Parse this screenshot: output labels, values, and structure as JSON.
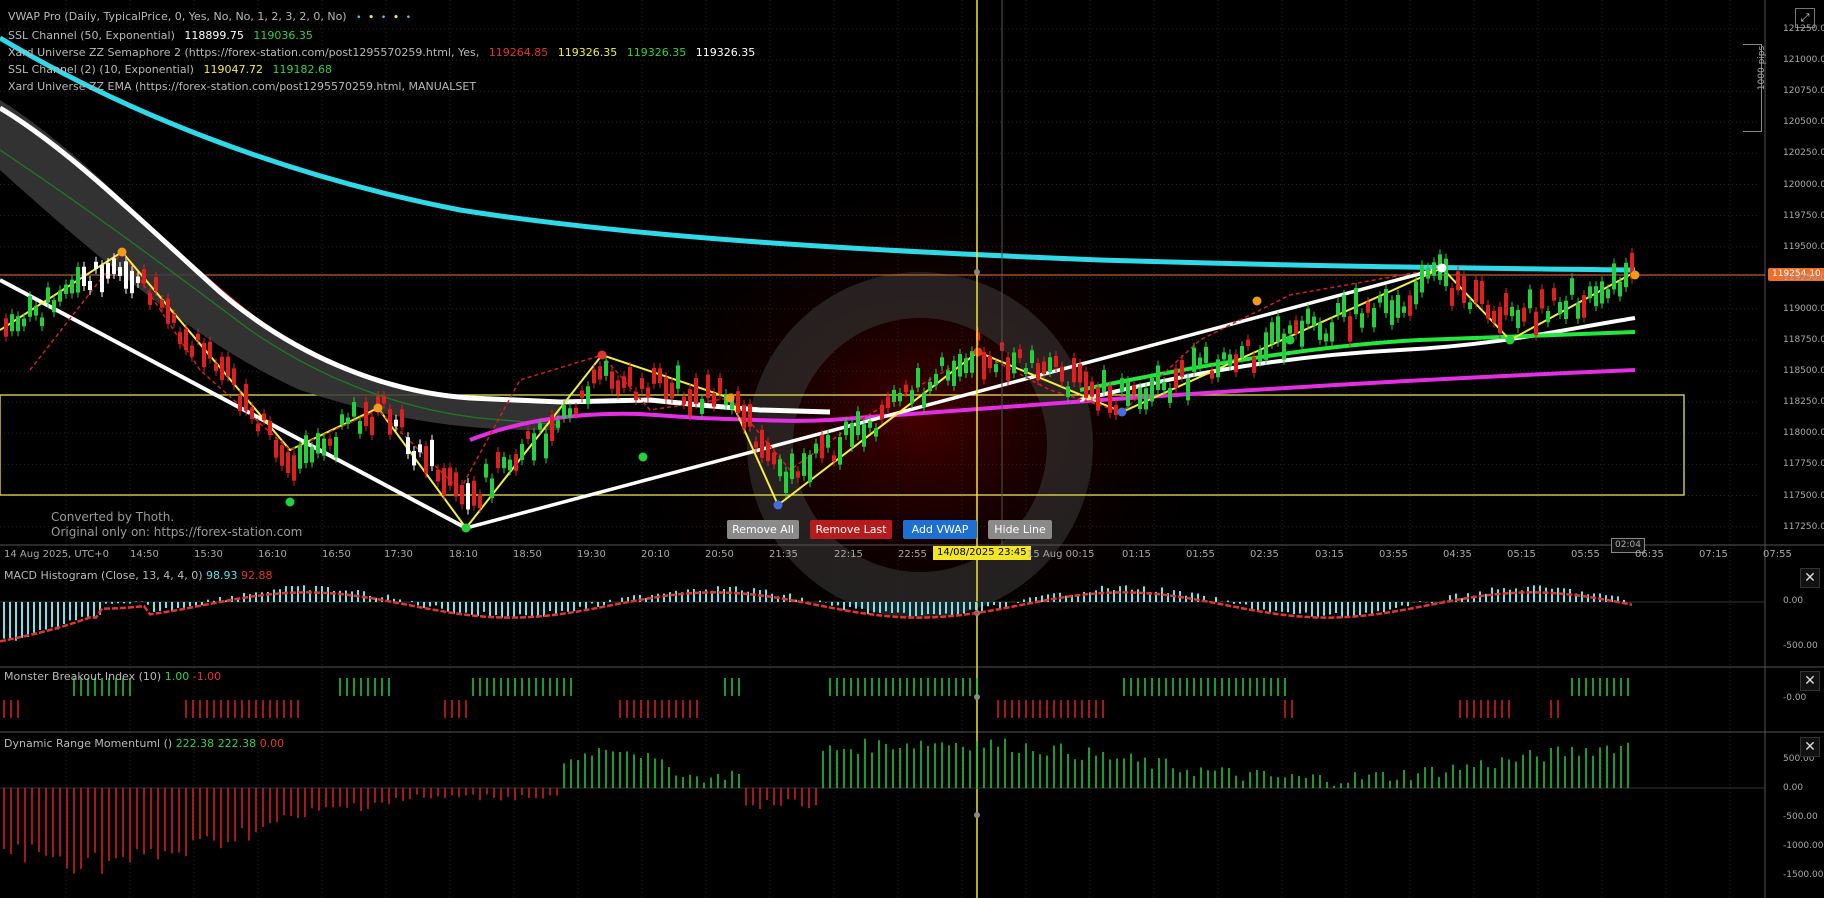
{
  "legend": {
    "vwap": {
      "label": "VWAP Pro (Daily, TypicalPrice, 0, Yes, No, No, 1, 2, 3, 2, 0, No)"
    },
    "ssl50": {
      "label": "SSL Channel (50, Exponential)",
      "v1": "118899.75",
      "v2": "119036.35"
    },
    "zz": {
      "label": "Xard Universe ZZ Semaphore 2 (https://forex-station.com/post1295570259.html, Yes,",
      "v1": "119264.85",
      "v2": "119326.35",
      "v3": "119326.35",
      "v4": "119326.35"
    },
    "ssl2": {
      "label": "SSL Channel (2) (10, Exponential)",
      "v1": "119047.72",
      "v2": "119182.68"
    },
    "ema": {
      "label": "Xard Universe ZZ EMA (https://forex-station.com/post1295570259.html, MANUALSET"
    }
  },
  "buttons": {
    "remove_all": "Remove All",
    "remove_last": "Remove Last",
    "add_vwap": "Add VWAP",
    "hide_line": "Hide Line"
  },
  "watermark": {
    "line1": "Converted by Thoth.",
    "line2": "Original only on: https://forex-station.com"
  },
  "pips_label": "1000 pips",
  "current_price": "119254.10",
  "cursor_date": "14/08/2025 23:45",
  "countdown": "02:04",
  "price_axis": [
    "121250.00",
    "121000.00",
    "120750.00",
    "120500.00",
    "120250.00",
    "120000.00",
    "119750.00",
    "119500.00",
    "119250.00",
    "119000.00",
    "118750.00",
    "118500.00",
    "118250.00",
    "118000.00",
    "117750.00",
    "117500.00",
    "117250.00"
  ],
  "time_axis": [
    "14 Aug 2025, UTC+0",
    "14:50",
    "15:30",
    "16:10",
    "16:50",
    "17:30",
    "18:10",
    "18:50",
    "19:30",
    "20:10",
    "20:50",
    "21:35",
    "22:15",
    "22:55",
    "",
    "15 Aug 00:15",
    "01:15",
    "01:55",
    "02:35",
    "03:15",
    "03:55",
    "04:35",
    "05:15",
    "05:55",
    "06:35",
    "07:15",
    "07:55"
  ],
  "panels": {
    "macd": {
      "label": "MACD Histogram (Close, 13, 4, 4, 0)",
      "v1": "98.93",
      "v2": "92.88",
      "axis": [
        "0.00",
        "-500.00"
      ]
    },
    "monster": {
      "label": "Monster Breakout Index (10)",
      "v1": "1.00",
      "v2": "-1.00",
      "axis": [
        "-0.00"
      ]
    },
    "drm": {
      "label": "Dynamic Range Momentuml ()",
      "v1": "222.38",
      "v2": "222.38",
      "v3": "0.00",
      "axis": [
        "500.00",
        "0.00",
        "-500.00",
        "-1000.00",
        "-1500.00"
      ]
    }
  },
  "colors": {
    "bull": "#22d13b",
    "bear": "#e01f1f",
    "vwap": "#2ed9e8",
    "magenta": "#e32ee3",
    "cursor": "#f3e625",
    "zigzag": "#f2f03a"
  }
}
